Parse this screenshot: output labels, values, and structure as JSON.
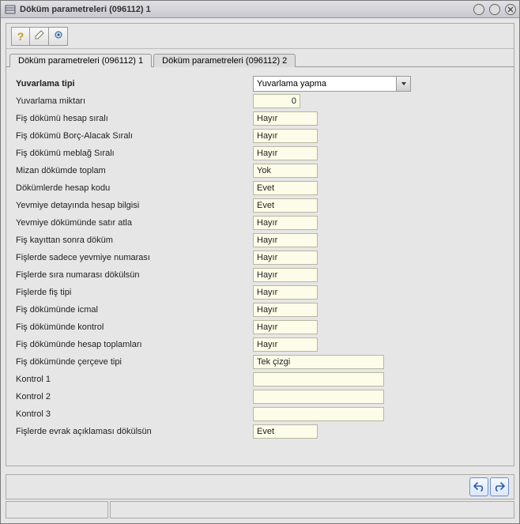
{
  "window": {
    "title": "Döküm parametreleri (096112) 1"
  },
  "tabs": [
    {
      "label": "Döküm parametreleri (096112) 1",
      "active": true
    },
    {
      "label": "Döküm parametreleri (096112) 2",
      "active": false
    }
  ],
  "header_row": {
    "label": "Yuvarlama tipi",
    "select_value": "Yuvarlama yapma"
  },
  "rows": [
    {
      "label": "Yuvarlama miktarı",
      "value": "0",
      "type": "num"
    },
    {
      "label": "Fiş dökümü hesap sıralı",
      "value": "Hayır",
      "type": "text"
    },
    {
      "label": "Fiş dökümü Borç-Alacak Sıralı",
      "value": "Hayır",
      "type": "text"
    },
    {
      "label": "Fiş dökümü meblağ Sıralı",
      "value": "Hayır",
      "type": "text"
    },
    {
      "label": "Mizan dökümde toplam",
      "value": "Yok",
      "type": "text"
    },
    {
      "label": "Dökümlerde hesap kodu",
      "value": "Evet",
      "type": "text"
    },
    {
      "label": "Yevmiye detayında hesap bilgisi",
      "value": "Evet",
      "type": "text"
    },
    {
      "label": "Yevmiye dökümünde satır atla",
      "value": "Hayır",
      "type": "text"
    },
    {
      "label": "Fiş kayıttan sonra döküm",
      "value": "Hayır",
      "type": "text"
    },
    {
      "label": "Fişlerde sadece yevmiye numarası",
      "value": "Hayır",
      "type": "text"
    },
    {
      "label": "Fişlerde sıra numarası dökülsün",
      "value": "Hayır",
      "type": "text"
    },
    {
      "label": "Fişlerde fiş tipi",
      "value": "Hayır",
      "type": "text"
    },
    {
      "label": "Fiş dökümünde icmal",
      "value": "Hayır",
      "type": "text"
    },
    {
      "label": "Fiş dökümünde kontrol",
      "value": "Hayır",
      "type": "text"
    },
    {
      "label": "Fiş dökümünde hesap toplamları",
      "value": "Hayır",
      "type": "text"
    },
    {
      "label": "Fiş dökümünde çerçeve tipi",
      "value": "Tek çizgi",
      "type": "wide"
    },
    {
      "label": "Kontrol 1",
      "value": "",
      "type": "wide"
    },
    {
      "label": "Kontrol 2",
      "value": "",
      "type": "wide"
    },
    {
      "label": "Kontrol 3",
      "value": "",
      "type": "wide"
    },
    {
      "label": "Fişlerde evrak açıklaması dökülsün",
      "value": "Evet",
      "type": "text"
    }
  ]
}
